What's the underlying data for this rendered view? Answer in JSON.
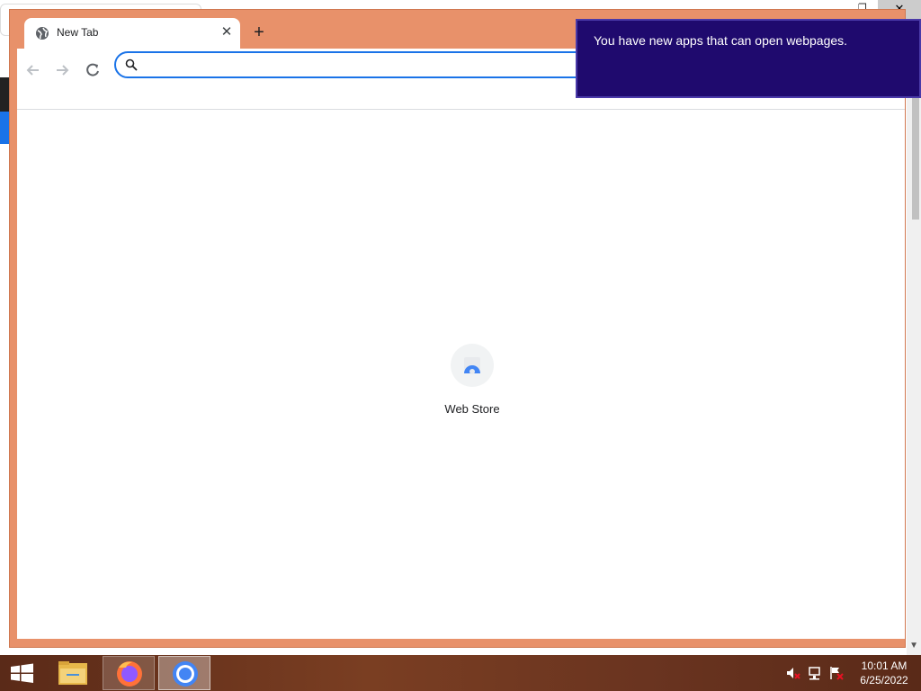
{
  "browser": {
    "tab": {
      "title": "New Tab",
      "close_glyph": "✕"
    },
    "new_tab_glyph": "+",
    "omnibox": {
      "value": "",
      "placeholder": ""
    },
    "shortcuts": [
      {
        "label": "Web Store",
        "icon": "webstore-icon"
      }
    ]
  },
  "notification": {
    "text": "You have new apps that can open webpages."
  },
  "background_window": {
    "close_glyph": "✕",
    "maximize_glyph": "❐",
    "scroll_arrow": "▼"
  },
  "taskbar": {
    "apps": [
      {
        "name": "File Explorer",
        "icon": "folder-icon"
      },
      {
        "name": "Firefox",
        "icon": "firefox-icon"
      },
      {
        "name": "Chrome",
        "icon": "chrome-icon"
      }
    ],
    "tray": {
      "icons": [
        "volume-muted-icon",
        "network-icon",
        "action-center-flag-icon"
      ]
    },
    "clock": {
      "time": "10:01 AM",
      "date": "6/25/2022"
    }
  },
  "colors": {
    "frame": "#e8916a",
    "notification_bg": "#1f0a6e",
    "omnibox_focus": "#1a73e8",
    "taskbar": "#6a3420"
  }
}
